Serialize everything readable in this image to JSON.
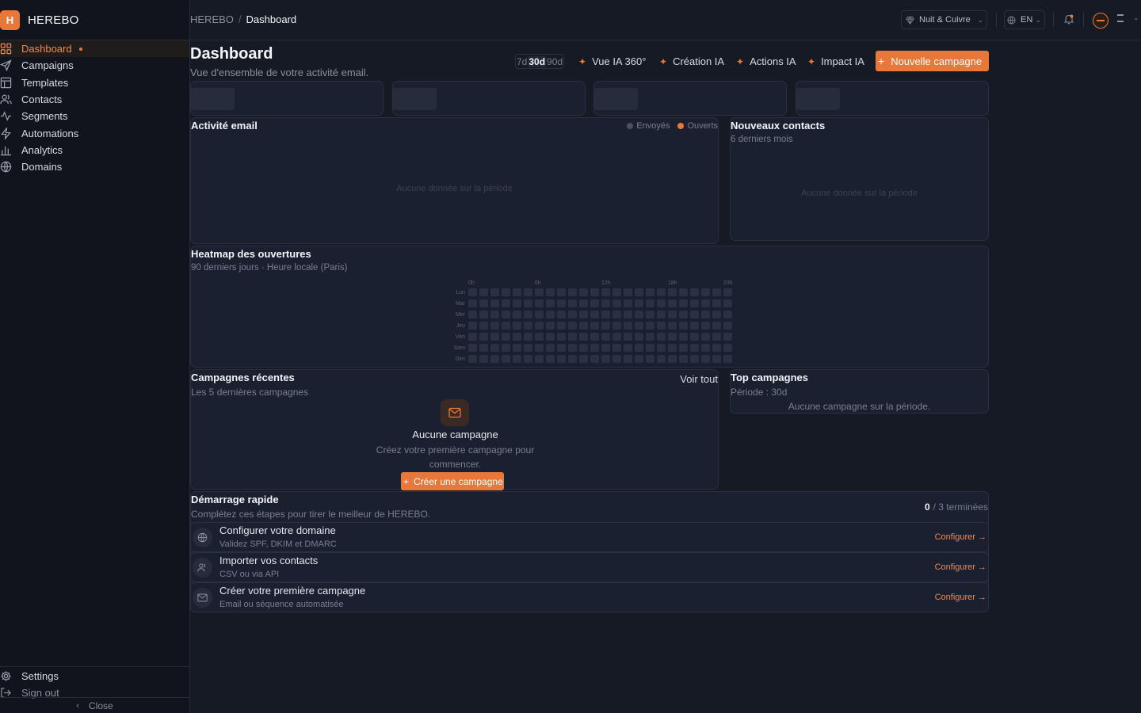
{
  "brand": {
    "logo_letter": "H",
    "name": "HEREBO"
  },
  "nav": {
    "items": [
      {
        "label": "Dashboard",
        "icon": "grid-icon"
      },
      {
        "label": "Campaigns",
        "icon": "send-icon"
      },
      {
        "label": "Templates",
        "icon": "layout-icon"
      },
      {
        "label": "Contacts",
        "icon": "users-icon"
      },
      {
        "label": "Segments",
        "icon": "activity-icon"
      },
      {
        "label": "Automations",
        "icon": "zap-icon"
      },
      {
        "label": "Analytics",
        "icon": "bar-chart-icon"
      },
      {
        "label": "Domains",
        "icon": "globe-icon"
      }
    ],
    "active_index": 0
  },
  "sidebar_bottom": {
    "settings": "Settings",
    "sign_out": "Sign out",
    "close": "Close"
  },
  "topbar": {
    "breadcrumb_root": "HEREBO",
    "breadcrumb_sep": "/",
    "breadcrumb_current": "Dashboard",
    "theme": "Nuit & Cuivre",
    "language": "EN"
  },
  "header": {
    "title": "Dashboard",
    "subtitle": "Vue d'ensemble de votre activité email.",
    "ranges": [
      "7d",
      "30d",
      "90d"
    ],
    "selected_range": "30d",
    "ai_buttons": [
      "Vue IA 360°",
      "Création IA",
      "Actions IA",
      "Impact IA"
    ],
    "new_campaign": "Nouvelle campagne"
  },
  "activity": {
    "title": "Activité email",
    "legend_sent": "Envoyés",
    "legend_opened": "Ouverts",
    "empty": "Aucune donnée sur la période"
  },
  "new_contacts": {
    "title": "Nouveaux contacts",
    "subtitle": "6 derniers mois",
    "empty": "Aucune donnée sur la période"
  },
  "heatmap": {
    "title": "Heatmap des ouvertures",
    "subtitle": "90 derniers jours · Heure locale (Paris)",
    "hour_labels": [
      "0h",
      "6h",
      "12h",
      "18h",
      "23h"
    ],
    "days": [
      "Lun",
      "Mar",
      "Mer",
      "Jeu",
      "Ven",
      "Sam",
      "Dim"
    ],
    "hours": 24
  },
  "recent_campaigns": {
    "title": "Campagnes récentes",
    "subtitle": "Les 5 dernières campagnes",
    "see_all": "Voir tout",
    "empty_title": "Aucune campagne",
    "empty_desc": "Créez votre première campagne pour commencer.",
    "create": "Créer une campagne"
  },
  "top_campaigns": {
    "title": "Top campagnes",
    "period": "Période : 30d",
    "empty": "Aucune campagne sur la période."
  },
  "quick_start": {
    "title": "Démarrage rapide",
    "subtitle": "Complétez ces étapes pour tirer le meilleur de HEREBO.",
    "done_count": "0",
    "done_total": "/ 3 terminées",
    "steps": [
      {
        "title": "Configurer votre domaine",
        "desc": "Validez SPF, DKIM et DMARC",
        "action": "Configurer →",
        "icon": "globe-icon"
      },
      {
        "title": "Importer vos contacts",
        "desc": "CSV ou via API",
        "action": "Configurer →",
        "icon": "users-icon"
      },
      {
        "title": "Créer votre première campagne",
        "desc": "Email ou séquence automatisée",
        "action": "Configurer →",
        "icon": "mail-icon"
      }
    ]
  },
  "colors": {
    "accent": "#e8783a",
    "background": "#161a24",
    "card": "#1b2030",
    "sent_dot": "#4a5060"
  }
}
